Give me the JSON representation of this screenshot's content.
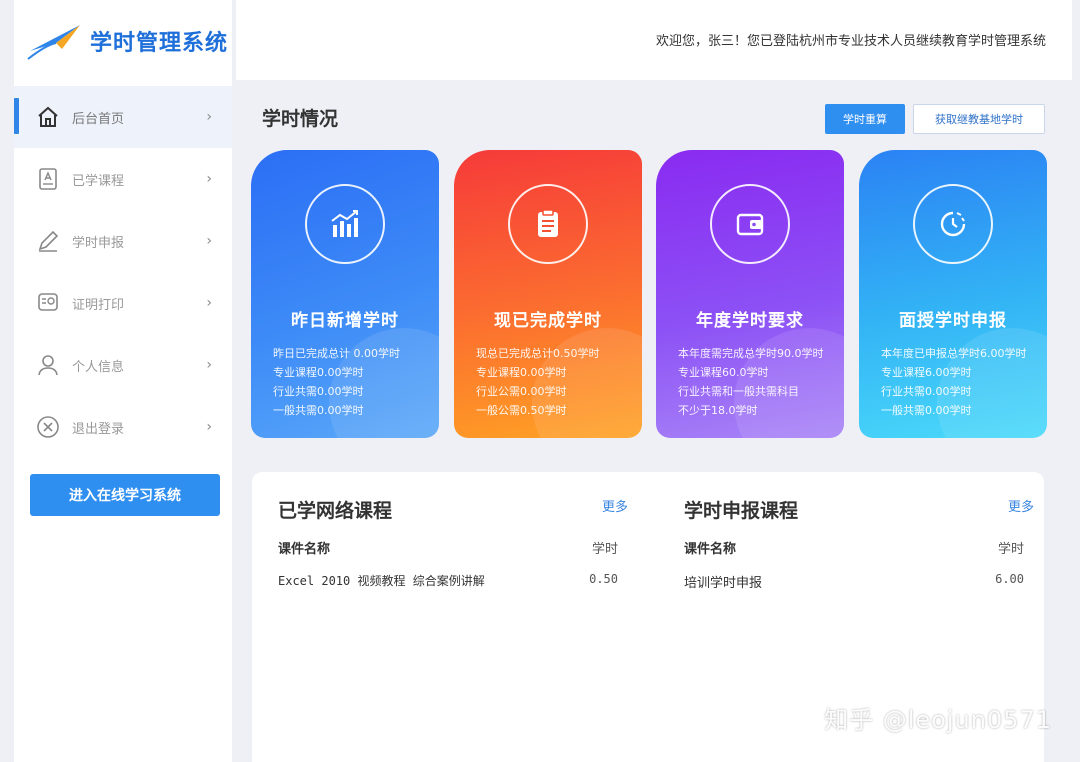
{
  "app": {
    "logo_text": "学时管理系统",
    "welcome": "欢迎您，张三！您已登陆杭州市专业技术人员继续教育学时管理系统"
  },
  "sidebar": {
    "items": [
      {
        "label": "后台首页",
        "icon": "home-icon",
        "arrow": "›",
        "active": true
      },
      {
        "label": "已学课程",
        "icon": "book-icon",
        "arrow": "›"
      },
      {
        "label": "学时申报",
        "icon": "pen-icon",
        "arrow": "›"
      },
      {
        "label": "证明打印",
        "icon": "certificate-icon",
        "arrow": "›"
      },
      {
        "label": "个人信息",
        "icon": "user-icon",
        "arrow": "›"
      },
      {
        "label": "退出登录",
        "icon": "logout-icon",
        "arrow": "›"
      }
    ],
    "enter_button": "进入在线学习系统"
  },
  "main": {
    "section_title": "学时情况",
    "btn_calc": "学时重算",
    "btn_get": "获取继教基地学时",
    "cards": [
      {
        "title": "昨日新增学时",
        "icon": "growth-chart-icon",
        "lines": [
          "昨日已完成总计 0.00学时",
          "专业课程0.00学时",
          "行业共需0.00学时",
          "一般共需0.00学时"
        ]
      },
      {
        "title": "现已完成学时",
        "icon": "clipboard-icon",
        "lines": [
          "现总已完成总计0.50学时",
          "专业课程0.00学时",
          "行业公需0.00学时",
          "一般公需0.50学时"
        ]
      },
      {
        "title": "年度学时要求",
        "icon": "wallet-icon",
        "lines": [
          "本年度需完成总学时90.0学时",
          "专业课程60.0学时",
          "行业共需和一般共需科目",
          "不少于18.0学时"
        ]
      },
      {
        "title": "面授学时申报",
        "icon": "clock-icon",
        "lines": [
          "本年度已申报总学时6.00学时",
          "专业课程6.00学时",
          "行业共需0.00学时",
          "一般共需0.00学时"
        ]
      }
    ]
  },
  "learned": {
    "title": "已学网络课程",
    "more": "更多",
    "col_name": "课件名称",
    "col_hours": "学时",
    "rows": [
      {
        "name": "Excel 2010 视频教程 综合案例讲解",
        "hours": "0.50"
      }
    ]
  },
  "declared": {
    "title": "学时申报课程",
    "more": "更多",
    "col_name": "课件名称",
    "col_hours": "学时",
    "rows": [
      {
        "name": "培训学时申报",
        "hours": "6.00"
      }
    ]
  },
  "watermark": "知乎 @leojun0571",
  "colors": {
    "accent": "#2f8ff0",
    "card_blue": "#2b6ef5",
    "card_orange": "#fb6a30",
    "card_purple": "#8a2bf1",
    "card_cyan": "#33b4f5"
  }
}
